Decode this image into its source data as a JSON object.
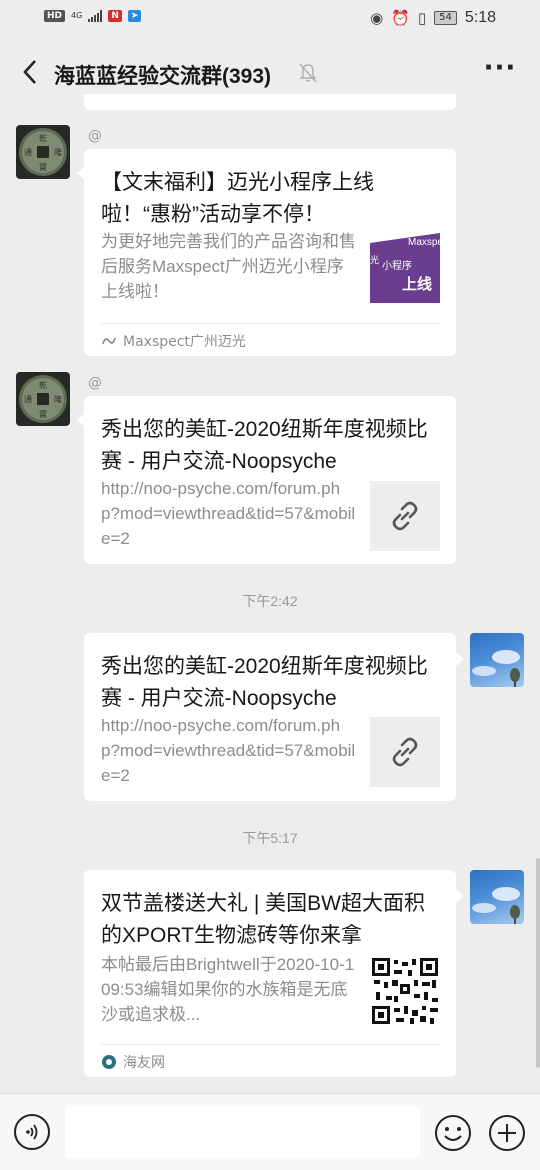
{
  "status_bar": {
    "chip_hd": "HD",
    "network": "4G",
    "chip_red": "N",
    "battery": "54",
    "time": "5:18"
  },
  "header": {
    "title": "海蓝蓝经验交流群(393)",
    "more_label": "···"
  },
  "messages": [
    {
      "sender": "@",
      "title": "【文末福利】迈光小程序上线啦！“惠粉”活动享不停！",
      "description": "为更好地完善我们的产品咨询和售后服务Maxspect广州迈光小程序上线啦！",
      "thumb_text_1": "Maxspec",
      "thumb_text_2": "小程序",
      "thumb_text_3": "上线",
      "thumb_text_4": "光",
      "source": "Maxspect广州迈光"
    },
    {
      "sender": "@",
      "title": "秀出您的美缸-2020纽斯年度视频比赛 - 用户交流-Noopsyche",
      "description": "http://noo-psyche.com/forum.php?mod=viewthread&tid=57&mobile=2"
    },
    {
      "time": "下午2:42",
      "title": "秀出您的美缸-2020纽斯年度视频比赛 - 用户交流-Noopsyche",
      "description": "http://noo-psyche.com/forum.php?mod=viewthread&tid=57&mobile=2"
    },
    {
      "time": "下午5:17",
      "title": "双节盖楼送大礼 | 美国BW超大面积的XPORT生物滤砖等你来拿",
      "description": "本帖最后由Brightwell于2020-10-109:53编辑如果你的水族箱是无底沙或追求极...",
      "source": "海友网"
    }
  ],
  "input": {
    "placeholder": ""
  },
  "colors": {
    "background": "#ededed",
    "card": "#ffffff",
    "accent_purple": "#6a3d8f"
  }
}
